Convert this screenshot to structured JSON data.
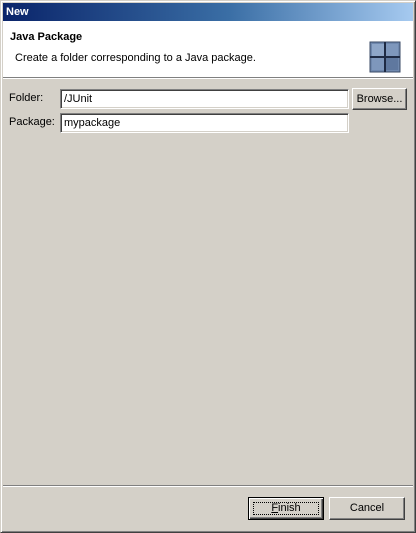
{
  "window": {
    "title": "New"
  },
  "banner": {
    "title": "Java Package",
    "description": "Create a folder corresponding to a Java package.",
    "icon": "package-wizard-icon"
  },
  "form": {
    "folder": {
      "label": "Folder:",
      "value": "/JUnit",
      "browse_label": "Browse..."
    },
    "package": {
      "label": "Package:",
      "value": "mypackage"
    }
  },
  "footer": {
    "finish_mnemonic": "F",
    "finish_rest": "inish",
    "cancel_label": "Cancel"
  },
  "colors": {
    "titlebar_start": "#0a246a",
    "titlebar_end": "#a6caf0",
    "dialog_bg": "#d4d0c8"
  }
}
